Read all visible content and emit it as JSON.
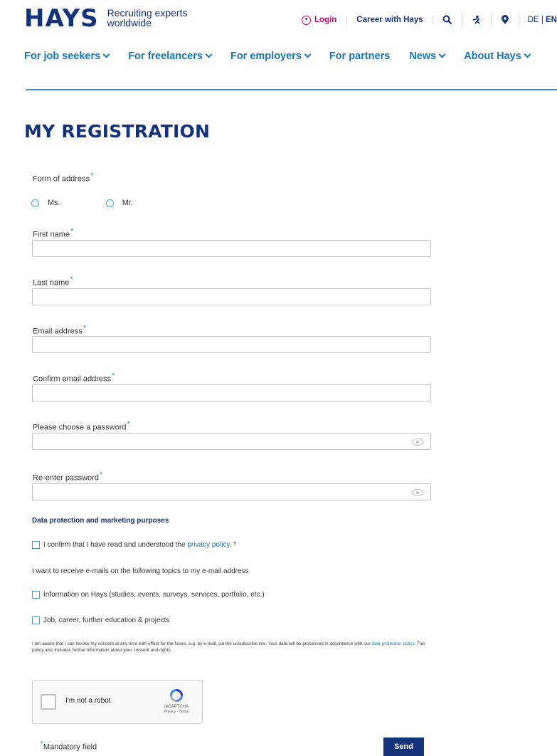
{
  "header": {
    "logo_text": "HAYS",
    "tagline_line1": "Recruiting experts",
    "tagline_line2": "worldwide",
    "login_label": "Login",
    "career_label": "Career with Hays",
    "lang_de": "DE",
    "lang_sep": "|",
    "lang_en": "EN",
    "icons": [
      "user-circle-icon",
      "search-icon",
      "accessibility-icon",
      "location-pin-icon"
    ]
  },
  "nav": {
    "items": [
      {
        "label": "For job seekers",
        "has_menu": true
      },
      {
        "label": "For freelancers",
        "has_menu": true
      },
      {
        "label": "For employers",
        "has_menu": true
      },
      {
        "label": "For partners",
        "has_menu": false
      },
      {
        "label": "News",
        "has_menu": true
      },
      {
        "label": "About Hays",
        "has_menu": true
      }
    ]
  },
  "page": {
    "title": "MY REGISTRATION"
  },
  "form": {
    "required_mark": "*",
    "form_of_address_label": "Form of address",
    "salutation_options": [
      "Ms.",
      "Mr."
    ],
    "first_name_label": "First name",
    "first_name_value": "",
    "last_name_label": "Last name",
    "last_name_value": "",
    "email_label": "Email address",
    "email_value": "",
    "confirm_email_label": "Confirm email address",
    "confirm_email_value": "",
    "password_label": "Please choose a password",
    "password_value": "",
    "reenter_password_label": "Re-enter password",
    "reenter_password_value": ""
  },
  "privacy": {
    "heading": "Data protection and marketing purposes",
    "confirm_prefix": "I confirm that I have read and understood the ",
    "confirm_link": "privacy policy.",
    "confirm_suffix": " *",
    "emails_intro": "I want to receive e-mails on the following topics to my e-mail address",
    "topic_hays": "Information on Hays (studies, events, surveys, services, portfolio, etc.)",
    "topic_career": "Job, career, further education & projects",
    "consent_prefix": "I am aware that I can revoke my consent at any time with effect for the future, e.g. by e-mail, via the unsubscribe link. Your data will be processed in accordance with our ",
    "consent_link": "data protection policy",
    "consent_suffix": ". This policy also includes further information about your consent and rights."
  },
  "recaptcha": {
    "label": "I'm not a robot",
    "brand": "reCAPTCHA",
    "terms": "Privacy - Terms"
  },
  "footer": {
    "mandatory_star": "*",
    "mandatory_label": "Mandatory field",
    "send_label": "Send"
  },
  "colors": {
    "brand_navy": "#14327a",
    "link_blue": "#1a73b8",
    "login_magenta": "#d8006b",
    "accent_line": "#3d9ad5"
  }
}
